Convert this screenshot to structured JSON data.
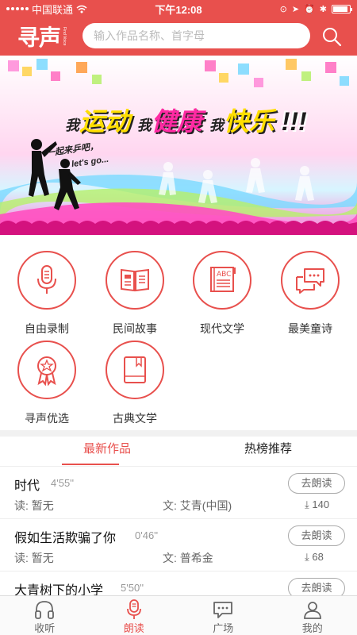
{
  "status": {
    "carrier": "中国联通",
    "time": "下午12:08"
  },
  "header": {
    "logo_text": "寻声",
    "logo_sub": "Find Voice",
    "search_placeholder": "输入作品名称、首字母"
  },
  "banner": {
    "title_parts": [
      "我",
      "运动",
      "我",
      "健康",
      "我",
      "快乐",
      "!!!"
    ],
    "slogan_1": "一起来乒吧，",
    "slogan_2": "let's go..."
  },
  "categories": [
    {
      "label": "自由录制",
      "icon": "microphone-icon"
    },
    {
      "label": "民间故事",
      "icon": "open-book-icon"
    },
    {
      "label": "现代文学",
      "icon": "abc-book-icon"
    },
    {
      "label": "最美童诗",
      "icon": "chat-bubbles-icon"
    },
    {
      "label": "寻声优选",
      "icon": "badge-ribbon-icon"
    },
    {
      "label": "古典文学",
      "icon": "closed-book-icon"
    }
  ],
  "tabs": [
    {
      "label": "最新作品",
      "active": true
    },
    {
      "label": "热榜推荐",
      "active": false
    }
  ],
  "list": [
    {
      "title": "时代",
      "duration": "4'55''",
      "reader": "读:  暂无",
      "author": "文:  艾青(中国)",
      "count": "140",
      "button": "去朗读"
    },
    {
      "title": "假如生活欺骗了你",
      "duration": "0'46''",
      "reader": "读:  暂无",
      "author": "文:  普希金",
      "count": "68",
      "button": "去朗读"
    },
    {
      "title": "大青树下的小学",
      "duration": "5'50''",
      "reader": "",
      "author": "",
      "count": "",
      "button": "去朗读"
    }
  ],
  "bottom_nav": [
    {
      "label": "收听",
      "icon": "headphones-icon",
      "active": false
    },
    {
      "label": "朗读",
      "icon": "microphone-icon",
      "active": true
    },
    {
      "label": "广场",
      "icon": "chat-icon",
      "active": false
    },
    {
      "label": "我的",
      "icon": "user-icon",
      "active": false
    }
  ],
  "colors": {
    "brand": "#e8504d",
    "text": "#222222",
    "muted": "#666666"
  }
}
